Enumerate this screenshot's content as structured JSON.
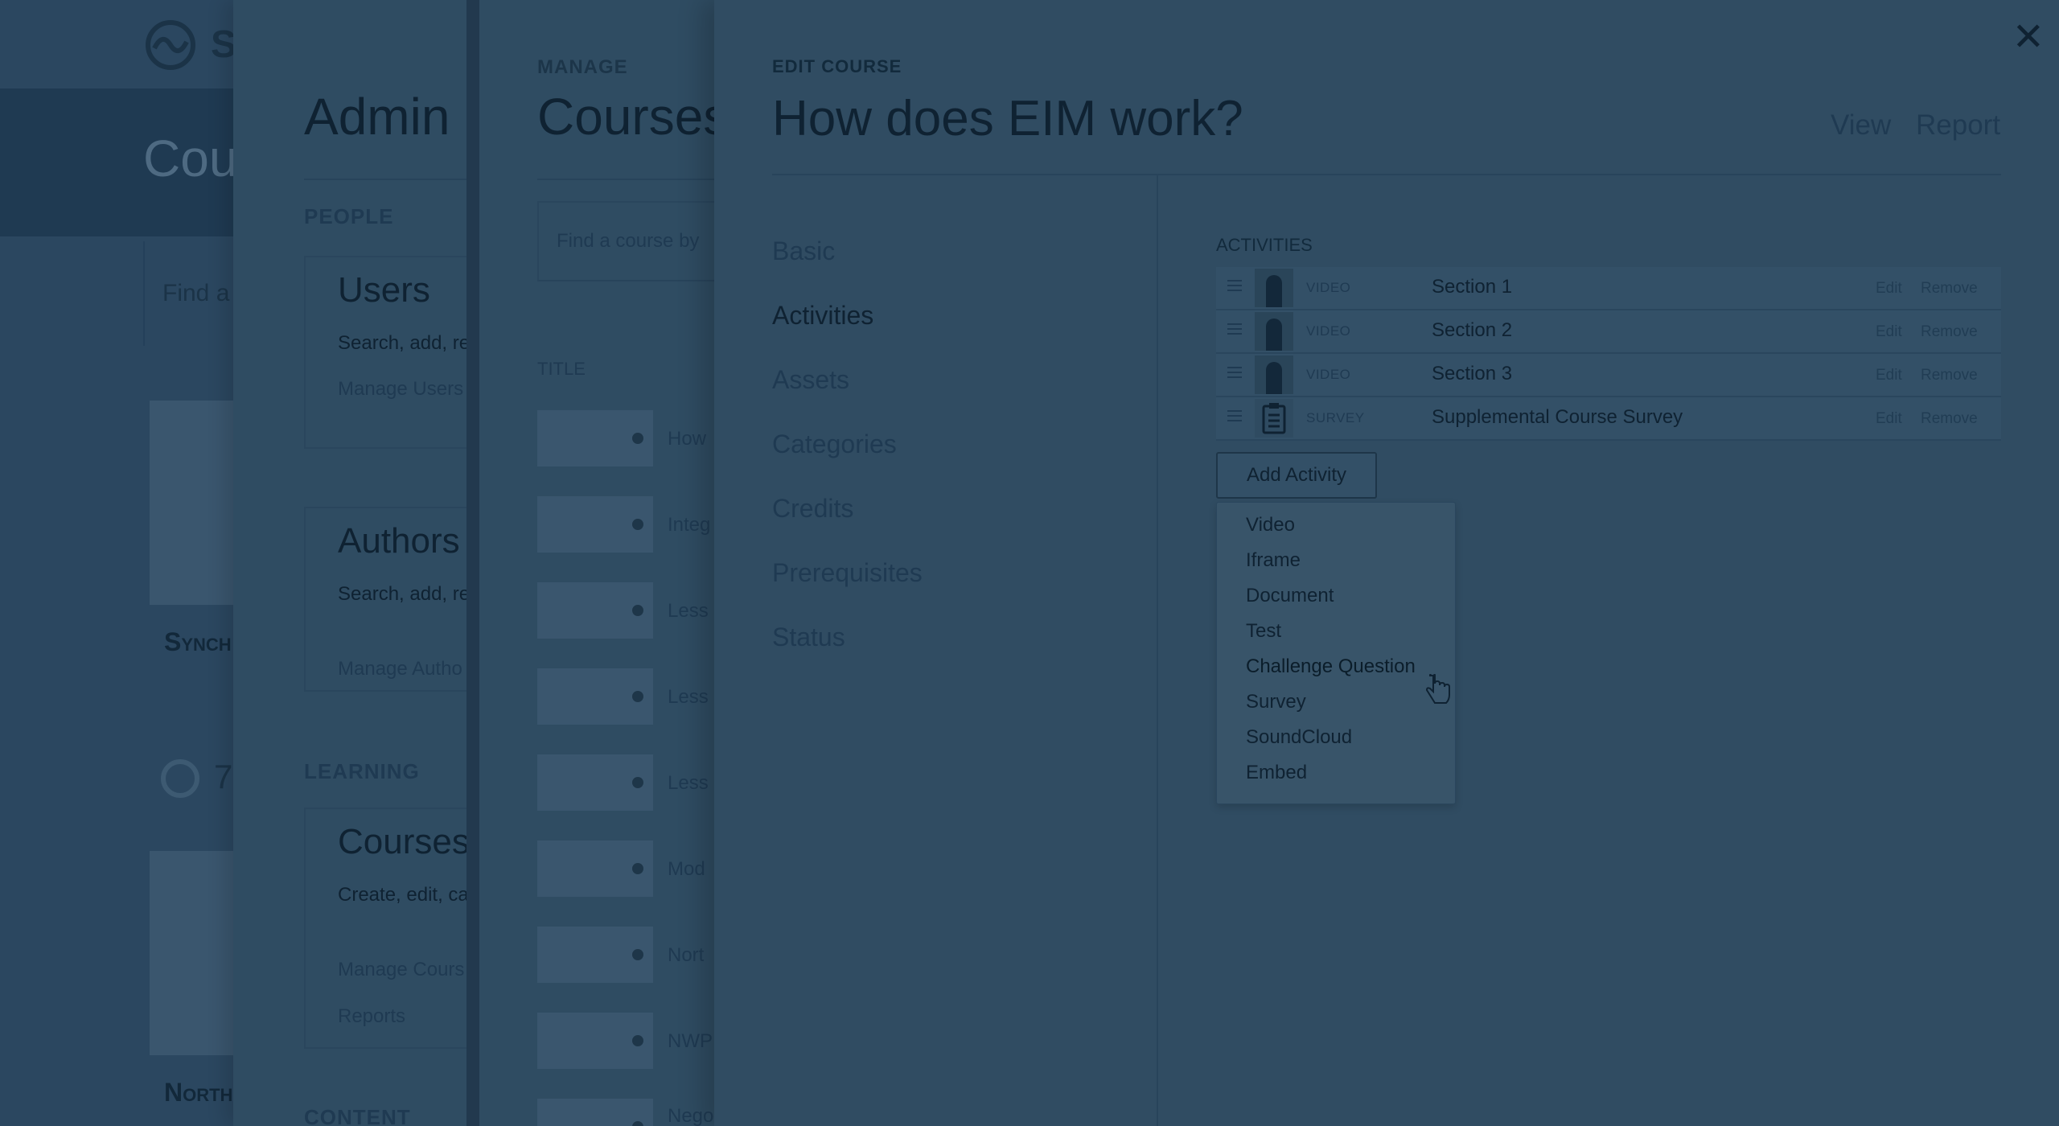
{
  "base": {
    "logo_text": "S",
    "hero_title": "Cou",
    "search_placeholder": "Find a",
    "cards": [
      "Synch",
      "North Coord"
    ],
    "rating": "7"
  },
  "admin": {
    "title": "Admin C",
    "sections": {
      "people": "PEOPLE",
      "learning": "LEARNING",
      "content": "CONTENT"
    },
    "cards": [
      {
        "title": "Users",
        "desc": "Search, add, re",
        "link": "Manage Users"
      },
      {
        "title": "Authors",
        "desc": "Search, add, re information.",
        "link": "Manage Autho"
      },
      {
        "title": "Courses",
        "desc": "Create, edit, ca the Course Libr",
        "link": "Manage Cours",
        "link2": "Reports"
      }
    ]
  },
  "manage": {
    "eyebrow": "MANAGE",
    "title": "Courses",
    "search_placeholder": "Find a course by",
    "column": "TITLE",
    "rows": [
      "How",
      "Integ",
      "Less",
      "Less",
      "Less",
      "Mod",
      "Nort",
      "NWP",
      "Nego"
    ]
  },
  "edit": {
    "close": "✕",
    "eyebrow": "EDIT COURSE",
    "title": "How does EIM work?",
    "view": "View",
    "report": "Report",
    "nav": [
      "Basic",
      "Activities",
      "Assets",
      "Categories",
      "Credits",
      "Prerequisites",
      "Status"
    ],
    "active_nav": "Activities",
    "activities_label": "ACTIVITIES",
    "activities": [
      {
        "type": "VIDEO",
        "name": "Section 1",
        "edit": "Edit",
        "remove": "Remove"
      },
      {
        "type": "VIDEO",
        "name": "Section 2",
        "edit": "Edit",
        "remove": "Remove"
      },
      {
        "type": "VIDEO",
        "name": "Section 3",
        "edit": "Edit",
        "remove": "Remove"
      },
      {
        "type": "SURVEY",
        "name": "Supplemental Course Survey",
        "edit": "Edit",
        "remove": "Remove"
      }
    ],
    "add_activity": "Add Activity",
    "dropdown": [
      "Video",
      "Iframe",
      "Document",
      "Test",
      "Challenge Question",
      "Survey",
      "SoundCloud",
      "Embed"
    ],
    "hovered_option": "Challenge Question"
  }
}
